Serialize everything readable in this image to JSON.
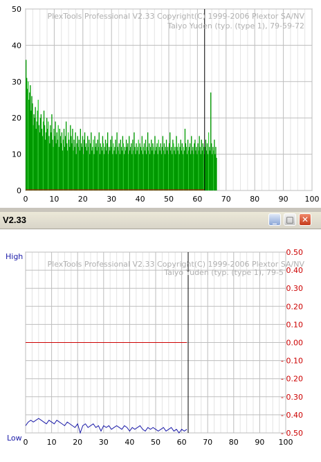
{
  "window": {
    "title": "V2.33",
    "minimize_glyph": "_",
    "maximize_glyph": "□",
    "close_glyph": "✕"
  },
  "watermark": {
    "line1": "PlexTools Professional V2.33 Copyright(C) 1999-2006 Plextor SA/NV",
    "line2_top": "Taiyo Yuden (typ. (type 1), 79-59-72",
    "line2_bottom": "Taiyo Yuden (typ. (type 1), 79-5"
  },
  "colors": {
    "error_fill": "#009900",
    "error_highlight": "#33cc33",
    "jitter_line": "#cc0000",
    "beta_line": "#1a1aa8",
    "right_axis": "#cc0000",
    "left_axis_label": "#1a1aa8",
    "grid": "#c8c8c8",
    "cursor": "#000000"
  },
  "chart_data": [
    {
      "type": "bar",
      "title": "",
      "xlabel": "",
      "ylabel": "",
      "xlim": [
        0,
        100
      ],
      "ylim": [
        0,
        50
      ],
      "x_ticks": [
        "0",
        "10",
        "20",
        "30",
        "40",
        "50",
        "60",
        "70",
        "80",
        "90",
        "100"
      ],
      "y_ticks": [
        "0",
        "10",
        "20",
        "30",
        "40",
        "50"
      ],
      "grid": true,
      "cursor_x": 62.5,
      "series": [
        {
          "x_step": 0.25,
          "values": [
            36,
            31,
            28,
            30,
            25,
            27,
            29,
            22,
            26,
            24,
            18,
            21,
            20,
            23,
            17,
            19,
            22,
            25,
            18,
            16,
            20,
            21,
            17,
            15,
            19,
            22,
            18,
            14,
            16,
            20,
            17,
            19,
            15,
            13,
            18,
            16,
            21,
            14,
            12,
            17,
            15,
            19,
            13,
            16,
            14,
            18,
            12,
            17,
            15,
            13,
            16,
            11,
            14,
            17,
            12,
            15,
            19,
            13,
            11,
            16,
            14,
            12,
            18,
            15,
            13,
            17,
            11,
            14,
            12,
            16,
            10,
            13,
            15,
            12,
            14,
            11,
            17,
            13,
            12,
            15,
            10,
            14,
            16,
            12,
            13,
            11,
            15,
            12,
            14,
            10,
            13,
            16,
            11,
            12,
            14,
            10,
            15,
            12,
            13,
            11,
            14,
            12,
            16,
            10,
            13,
            12,
            11,
            15,
            13,
            10,
            12,
            14,
            11,
            13,
            16,
            10,
            12,
            11,
            14,
            12,
            15,
            10,
            13,
            11,
            12,
            14,
            10,
            16,
            12,
            11,
            13,
            10,
            14,
            12,
            11,
            15,
            13,
            10,
            12,
            11,
            14,
            12,
            13,
            10,
            15,
            11,
            12,
            13,
            10,
            14,
            11,
            16,
            12,
            10,
            13,
            11,
            12,
            14,
            10,
            13,
            12,
            11,
            15,
            10,
            12,
            13,
            11,
            14,
            10,
            12,
            16,
            11,
            13,
            10,
            12,
            14,
            11,
            13,
            12,
            10,
            15,
            11,
            12,
            13,
            10,
            14,
            12,
            11,
            13,
            10,
            12,
            15,
            11,
            13,
            10,
            12,
            14,
            11,
            12,
            10,
            13,
            16,
            11,
            12,
            10,
            14,
            13,
            11,
            12,
            10,
            15,
            12,
            11,
            13,
            10,
            12,
            14,
            11,
            13,
            10,
            12,
            11,
            17,
            13,
            12,
            10,
            14,
            11,
            12,
            13,
            10,
            15,
            11,
            12,
            10,
            13,
            14,
            11,
            12,
            10,
            13,
            11,
            15,
            12,
            10,
            14,
            11,
            13,
            12,
            10,
            12,
            14,
            11,
            13,
            10,
            16,
            12,
            11,
            27,
            13,
            10,
            12,
            11,
            14,
            10,
            12,
            9
          ]
        }
      ]
    },
    {
      "type": "line",
      "title": "",
      "xlabel": "",
      "ylabel": "",
      "xlim": [
        0,
        100
      ],
      "x_ticks": [
        "0",
        "10",
        "20",
        "30",
        "40",
        "50",
        "60",
        "70",
        "80",
        "90",
        "100"
      ],
      "left_axis_labels": {
        "high": "High",
        "low": "Low"
      },
      "right_axis_ylim": [
        -0.5,
        0.5
      ],
      "right_ticks": [
        "0.50",
        "0.40",
        "0.30",
        "0.20",
        "0.10",
        "0.00",
        "- 0.10",
        "- 0.20",
        "- 0.30",
        "- 0.40",
        "- 0.50"
      ],
      "grid": true,
      "cursor_x": 62.5,
      "series": [
        {
          "axis": "right",
          "x_step": 1,
          "values": [
            0.0,
            0.0,
            0.0,
            0.0,
            0.0,
            0.0,
            0.0,
            0.0,
            0.0,
            0.0,
            0.0,
            0.0,
            0.0,
            0.0,
            0.0,
            0.0,
            0.0,
            0.0,
            0.0,
            0.0,
            0.0,
            0.0,
            0.0,
            0.0,
            0.0,
            0.0,
            0.0,
            0.0,
            0.0,
            0.0,
            0.0,
            0.0,
            0.0,
            0.0,
            0.0,
            0.0,
            0.0,
            0.0,
            0.0,
            0.0,
            0.0,
            0.0,
            0.0,
            0.0,
            0.0,
            0.0,
            0.0,
            0.0,
            0.0,
            0.0,
            0.0,
            0.0,
            0.0,
            0.0,
            0.0,
            0.0,
            0.0,
            0.0,
            0.0,
            0.0,
            0.0,
            0.0,
            0.0
          ]
        },
        {
          "axis": "right",
          "x_step": 1,
          "values": [
            -0.46,
            -0.44,
            -0.43,
            -0.44,
            -0.43,
            -0.42,
            -0.43,
            -0.44,
            -0.45,
            -0.43,
            -0.44,
            -0.45,
            -0.43,
            -0.44,
            -0.45,
            -0.46,
            -0.44,
            -0.45,
            -0.46,
            -0.47,
            -0.45,
            -0.5,
            -0.46,
            -0.45,
            -0.47,
            -0.46,
            -0.45,
            -0.47,
            -0.46,
            -0.49,
            -0.46,
            -0.47,
            -0.46,
            -0.48,
            -0.47,
            -0.46,
            -0.47,
            -0.48,
            -0.46,
            -0.47,
            -0.49,
            -0.47,
            -0.48,
            -0.47,
            -0.46,
            -0.48,
            -0.49,
            -0.47,
            -0.48,
            -0.47,
            -0.48,
            -0.49,
            -0.48,
            -0.47,
            -0.49,
            -0.48,
            -0.47,
            -0.49,
            -0.48,
            -0.5,
            -0.48,
            -0.49,
            -0.48
          ]
        }
      ]
    }
  ]
}
